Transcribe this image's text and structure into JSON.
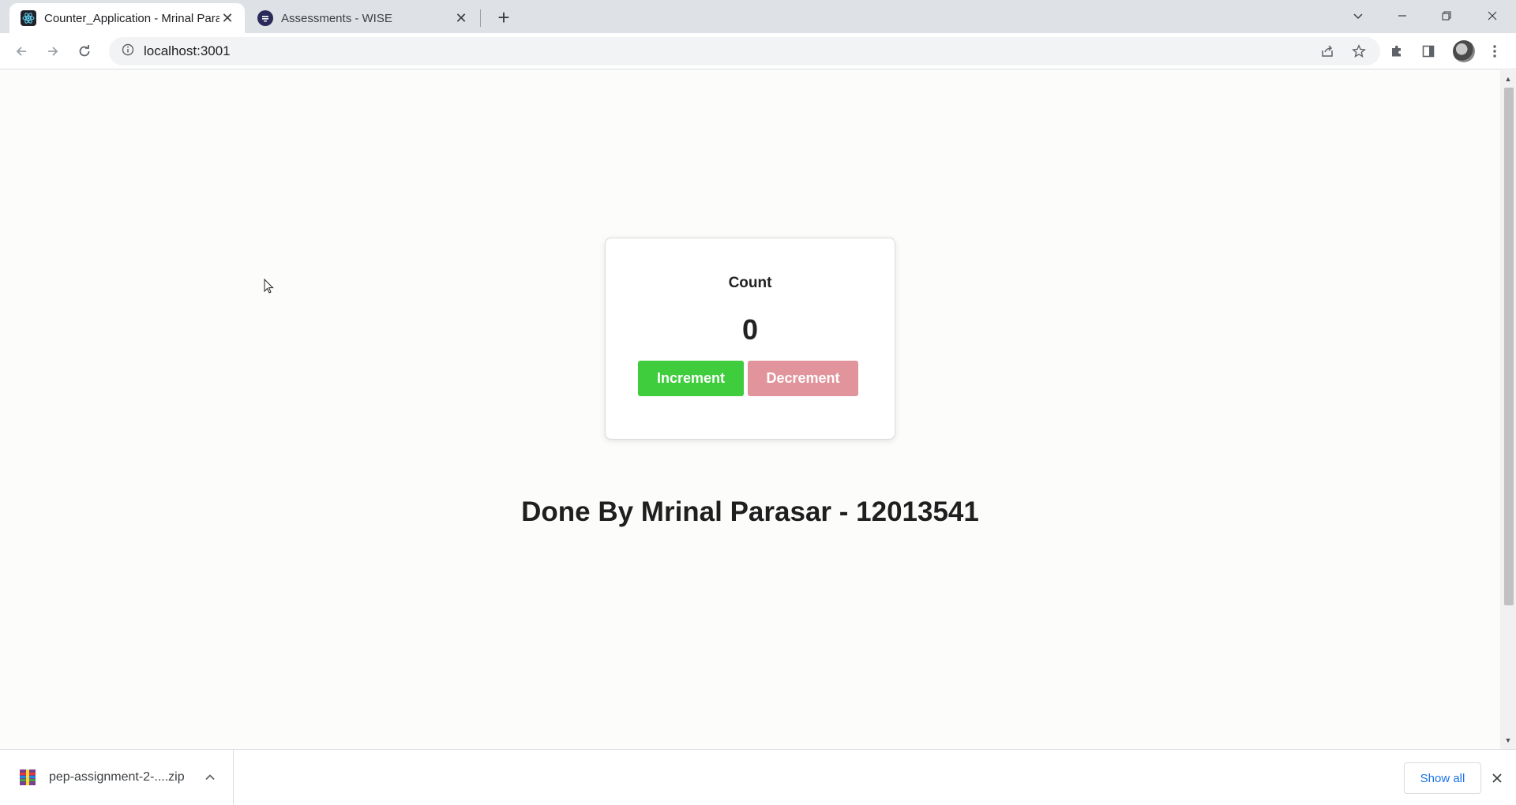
{
  "browser": {
    "tabs": [
      {
        "title": "Counter_Application - Mrinal Parasar",
        "icon": "react-icon",
        "active": true
      },
      {
        "title": "Assessments - WISE",
        "icon": "wise-icon",
        "active": false
      }
    ],
    "new_tab_label": "+",
    "url": "localhost:3001"
  },
  "app": {
    "count_label": "Count",
    "count_value": "0",
    "increment_label": "Increment",
    "decrement_label": "Decrement",
    "credit": "Done By Mrinal Parasar - 12013541"
  },
  "colors": {
    "increment": "#3fcc3d",
    "decrement": "#e1949c",
    "link": "#1a73e8"
  },
  "downloads": {
    "item_name": "pep-assignment-2-....zip",
    "show_all_label": "Show all"
  }
}
